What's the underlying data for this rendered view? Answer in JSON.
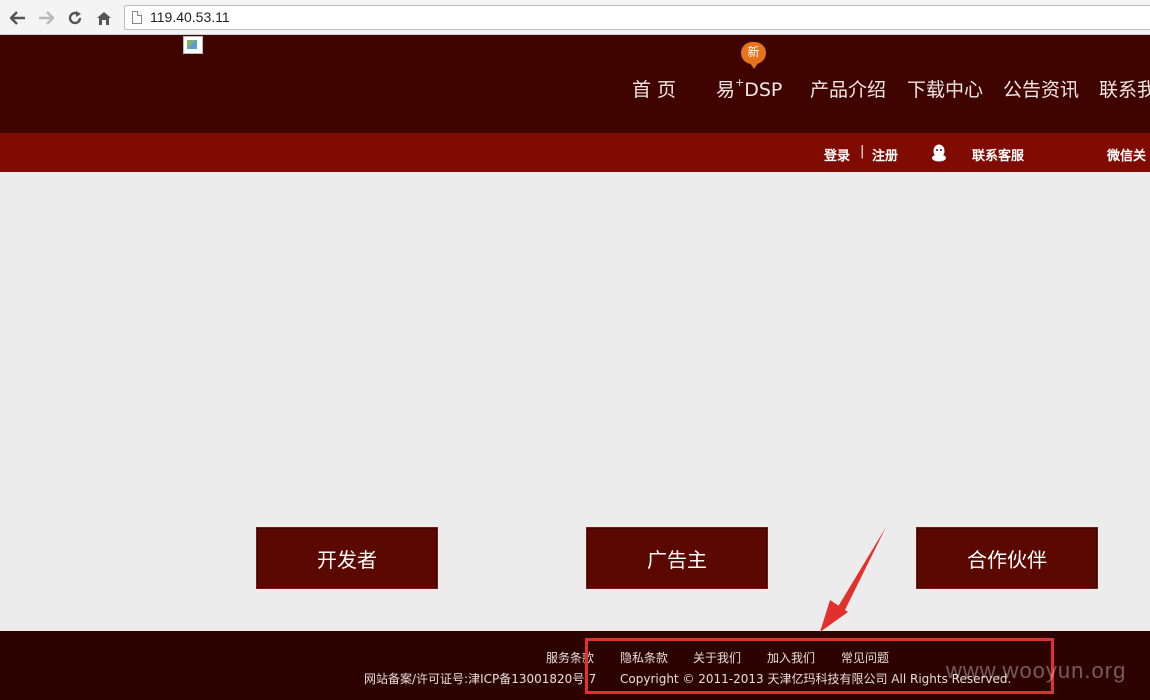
{
  "browser": {
    "url": "119.40.53.11",
    "back_icon": "arrow-left-icon",
    "forward_icon": "arrow-right-icon",
    "reload_icon": "reload-icon",
    "home_icon": "home-icon"
  },
  "header": {
    "new_badge": "新",
    "nav": [
      {
        "label": "首  页"
      },
      {
        "label_pre": "易",
        "label_sup": "+",
        "label_post": "DSP"
      },
      {
        "label": "产品介绍"
      },
      {
        "label": "下载中心"
      },
      {
        "label": "公告资讯"
      },
      {
        "label": "联系我"
      }
    ]
  },
  "subbar": {
    "login": "登录",
    "separator": "|",
    "register": "注册",
    "service": "联系客服",
    "wechat": "微信关"
  },
  "roles": {
    "developer": "开发者",
    "advertiser": "广告主",
    "partner": "合作伙伴"
  },
  "footer": {
    "links": [
      "服务条款",
      "隐私条款",
      "关于我们",
      "加入我们",
      "常见问题"
    ],
    "icp": "网站备案/许可证号:津ICP备13001820号-7",
    "copyright": "Copyright © 2011-2013 天津亿玛科技有限公司 All Rights Reserved.",
    "watermark": "www.wooyun.org"
  },
  "colors": {
    "header": "#3f0300",
    "subbar": "#7f0b03",
    "button": "#5b0800",
    "footer": "#2c0300",
    "annotation": "#e2302d",
    "badge": "#e8731d"
  }
}
